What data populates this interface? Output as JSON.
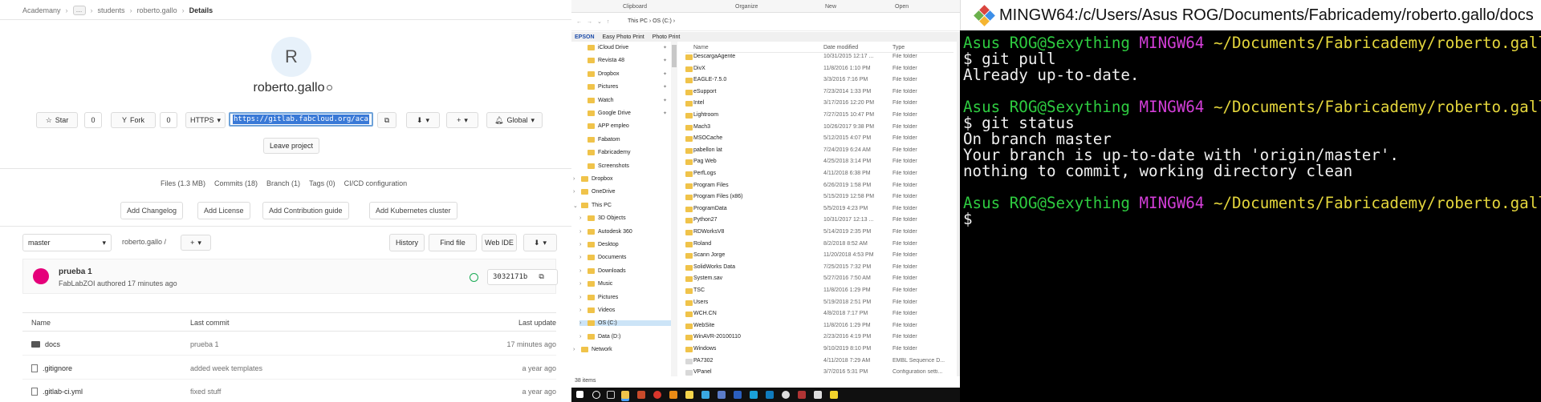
{
  "gitlab": {
    "breadcrumb": [
      "Academany",
      "…",
      "students",
      "roberto.gallo",
      "Details"
    ],
    "avatar_letter": "R",
    "project_name": "roberto.gallo",
    "star_label": "Star",
    "star_count": "0",
    "fork_label": "Fork",
    "fork_count": "0",
    "protocol_label": "HTTPS",
    "clone_url": "https://gitlab.fabcloud.org/aca",
    "notification_label": "Global",
    "leave_label": "Leave project",
    "stats": [
      "Files (1.3 MB)",
      "Commits (18)",
      "Branch (1)",
      "Tags (0)",
      "CI/CD configuration"
    ],
    "suggestions": [
      "Add Changelog",
      "Add License",
      "Add Contribution guide",
      "Add Kubernetes cluster"
    ],
    "branch": "master",
    "path": "roberto.gallo /",
    "history_label": "History",
    "find_label": "Find file",
    "webide_label": "Web IDE",
    "commit": {
      "title": "prueba 1",
      "meta": "FabLabZOI authored 17 minutes ago",
      "sha": "3032171b"
    },
    "table_headers": {
      "name": "Name",
      "last_commit": "Last commit",
      "last_update": "Last update"
    },
    "files": [
      {
        "name": "docs",
        "commit": "prueba 1",
        "updated": "17 minutes ago",
        "kind": "folder"
      },
      {
        "name": ".gitignore",
        "commit": "added week templates",
        "updated": "a year ago",
        "kind": "file"
      },
      {
        "name": ".gitlab-ci.yml",
        "commit": "fixed stuff",
        "updated": "a year ago",
        "kind": "file"
      }
    ]
  },
  "explorer": {
    "ribbon": [
      "Clipboard",
      "Organize",
      "New",
      "Open"
    ],
    "address": "This PC  ›  OS (C:)  ›",
    "epson": "EPSON",
    "epson_items": [
      "Easy Photo Print",
      "Photo Print"
    ],
    "nav_items": [
      "iCloud Drive",
      "Revista 48",
      "Dropbox",
      "Pictures",
      "Watch",
      "Google Drive",
      "APP empleo",
      "Fabatom",
      "Fabricademy",
      "Screenshots",
      "Dropbox",
      "OneDrive",
      "This PC",
      "3D Objects",
      "Autodesk 360",
      "Desktop",
      "Documents",
      "Downloads",
      "Music",
      "Pictures",
      "Videos",
      "OS (C:)",
      "Data (D:)",
      "Network"
    ],
    "headers": {
      "name": "Name",
      "date": "Date modified",
      "type": "Type"
    },
    "files": [
      {
        "n": "DescargaAgente",
        "d": "10/31/2015 12:17 ...",
        "t": "File folder"
      },
      {
        "n": "DivX",
        "d": "11/8/2016 1:10 PM",
        "t": "File folder"
      },
      {
        "n": "EAGLE-7.5.0",
        "d": "3/3/2016 7:16 PM",
        "t": "File folder"
      },
      {
        "n": "eSupport",
        "d": "7/23/2014 1:33 PM",
        "t": "File folder"
      },
      {
        "n": "Intel",
        "d": "3/17/2016 12:20 PM",
        "t": "File folder"
      },
      {
        "n": "Lightroom",
        "d": "7/27/2015 10:47 PM",
        "t": "File folder"
      },
      {
        "n": "Mach3",
        "d": "10/26/2017 9:38 PM",
        "t": "File folder"
      },
      {
        "n": "MSOCache",
        "d": "5/12/2015 4:07 PM",
        "t": "File folder"
      },
      {
        "n": "pabellon lat",
        "d": "7/24/2019 6:24 AM",
        "t": "File folder"
      },
      {
        "n": "Pag Web",
        "d": "4/25/2018 3:14 PM",
        "t": "File folder"
      },
      {
        "n": "PerfLogs",
        "d": "4/11/2018 6:38 PM",
        "t": "File folder"
      },
      {
        "n": "Program Files",
        "d": "6/26/2019 1:58 PM",
        "t": "File folder"
      },
      {
        "n": "Program Files (x86)",
        "d": "5/15/2019 12:58 PM",
        "t": "File folder"
      },
      {
        "n": "ProgramData",
        "d": "5/5/2019 4:23 PM",
        "t": "File folder"
      },
      {
        "n": "Python27",
        "d": "10/31/2017 12:13 ...",
        "t": "File folder"
      },
      {
        "n": "RDWorksV8",
        "d": "5/14/2019 2:35 PM",
        "t": "File folder"
      },
      {
        "n": "Roland",
        "d": "8/2/2018 8:52 AM",
        "t": "File folder"
      },
      {
        "n": "Scann Jorge",
        "d": "11/20/2018 4:53 PM",
        "t": "File folder"
      },
      {
        "n": "SolidWorks Data",
        "d": "7/25/2015 7:32 PM",
        "t": "File folder"
      },
      {
        "n": "System.sav",
        "d": "5/27/2016 7:50 AM",
        "t": "File folder"
      },
      {
        "n": "TSC",
        "d": "11/8/2016 1:29 PM",
        "t": "File folder"
      },
      {
        "n": "Users",
        "d": "5/19/2018 2:51 PM",
        "t": "File folder"
      },
      {
        "n": "WCH.CN",
        "d": "4/8/2018 7:17 PM",
        "t": "File folder"
      },
      {
        "n": "WebSite",
        "d": "11/8/2016 1:29 PM",
        "t": "File folder"
      },
      {
        "n": "WinAVR-20100110",
        "d": "2/23/2016 4:19 PM",
        "t": "File folder"
      },
      {
        "n": "Windows",
        "d": "9/10/2019 8:10 PM",
        "t": "File folder"
      },
      {
        "n": "PA7302",
        "d": "4/11/2018 7:29 AM",
        "t": "EMBL Sequence D..."
      },
      {
        "n": "VPanel",
        "d": "3/7/2016 5:31 PM",
        "t": "Configuration setti..."
      }
    ],
    "status": "38 items"
  },
  "terminal": {
    "title": "MINGW64:/c/Users/Asus ROG/Documents/Fabricademy/roberto.gallo/docs",
    "user": "Asus ROG@Sexything",
    "env": "MINGW64",
    "path": "~/Documents/Fabricademy/roberto.gallo/docs",
    "cmd1": "$ git pull",
    "out1": "Already up-to-date.",
    "cmd2": "$ git status",
    "out2": "On branch master",
    "out3": "Your branch is up-to-date with 'origin/master'.",
    "out4": "nothing to commit, working directory clean",
    "prompt": "$"
  },
  "colors": {
    "prompt_green": "#2ecc40",
    "prompt_magenta": "#d33ed8",
    "prompt_yellow": "#e4d63c",
    "url_highlight": "#3979d7"
  }
}
